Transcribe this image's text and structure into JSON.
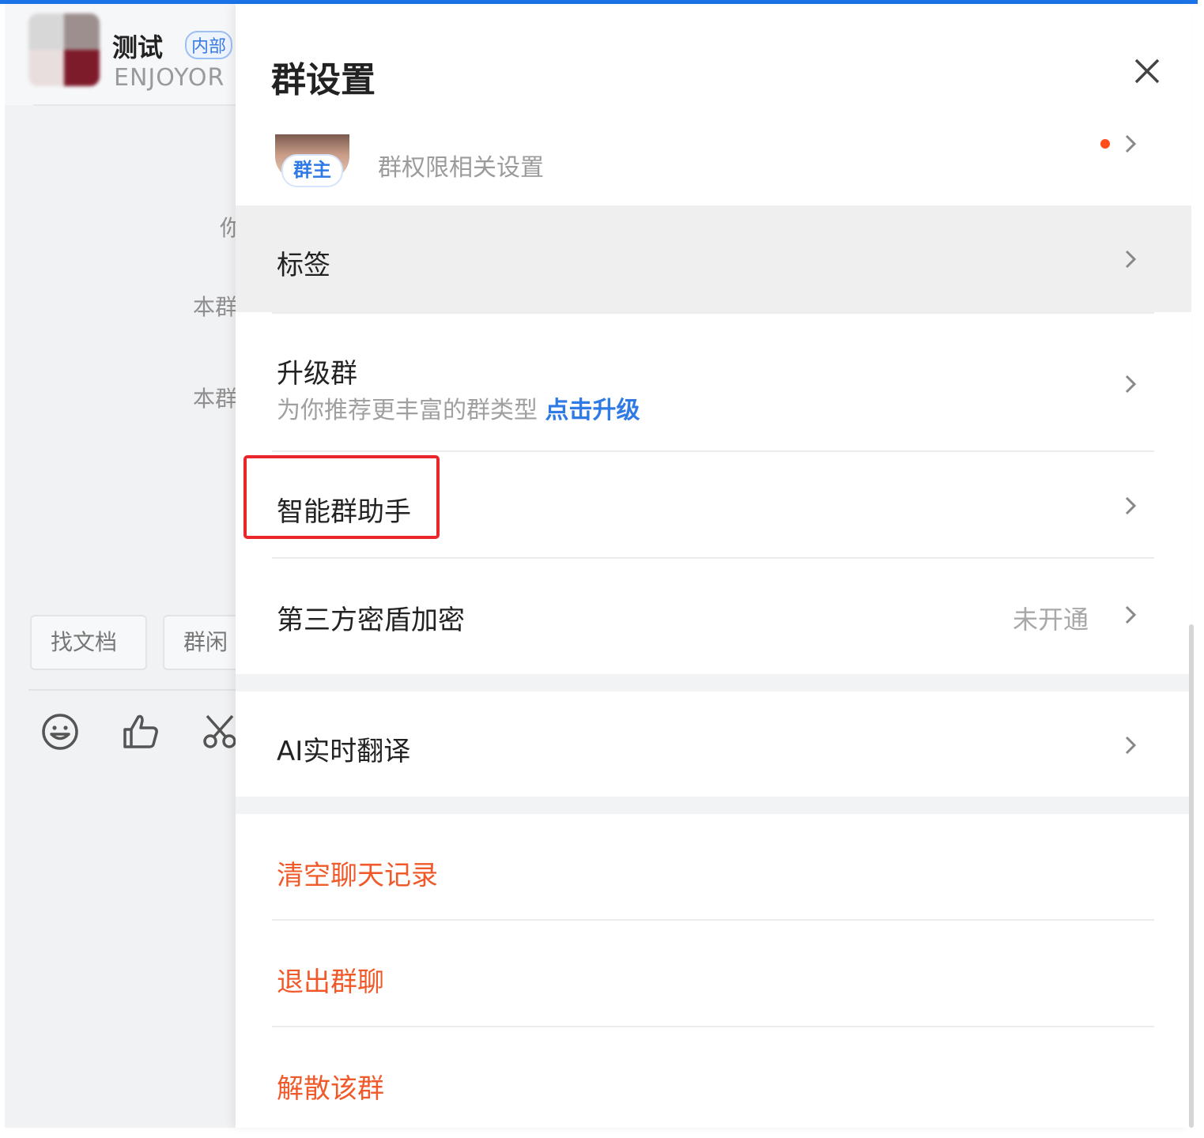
{
  "colors": {
    "accent": "#1a73e8",
    "link": "#2f7ae5",
    "danger": "#f05a2a",
    "highlight": "#e8262b",
    "notification_dot": "#ff4d1a"
  },
  "chat_window": {
    "title": "测试",
    "badge": "内部",
    "subtitle": "ENJOYOR",
    "background_texts": [
      "你",
      "本群",
      "本群"
    ],
    "quick_actions": [
      "找文档",
      "群闲"
    ],
    "toolbar_icons": [
      "emoji-icon",
      "thumbs-up-icon",
      "scissors-icon"
    ]
  },
  "settings": {
    "title": "群设置",
    "close_icon": "close-icon",
    "owner": {
      "badge": "群主",
      "description": "群权限相关设置"
    },
    "tags": {
      "label": "标签"
    },
    "upgrade": {
      "label": "升级群",
      "subtitle": "为你推荐更丰富的群类型",
      "link": "点击升级"
    },
    "assistant": {
      "label": "智能群助手"
    },
    "encryption": {
      "label": "第三方密盾加密",
      "status": "未开通"
    },
    "translate": {
      "label": "AI实时翻译"
    },
    "clear_history": {
      "label": "清空聊天记录"
    },
    "leave_group": {
      "label": "退出群聊"
    },
    "disband_group": {
      "label": "解散该群"
    }
  }
}
